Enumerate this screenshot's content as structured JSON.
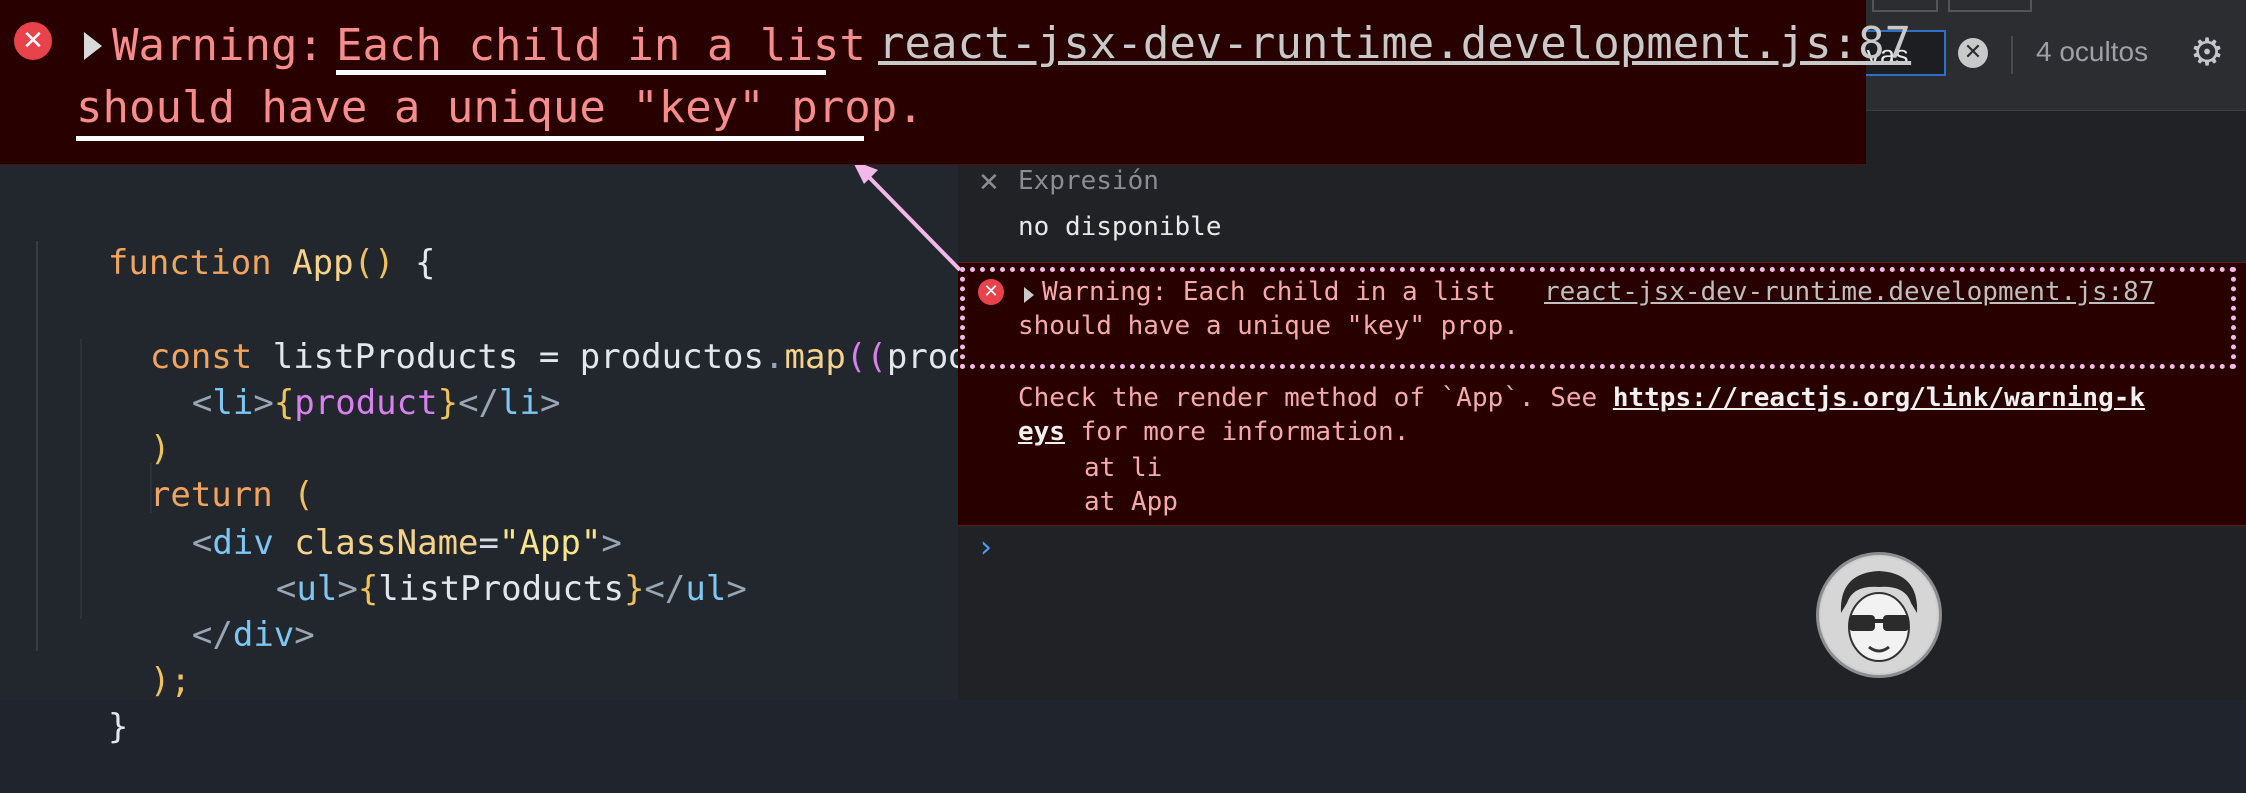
{
  "callout": {
    "warning_prefix": "Warning: ",
    "warning_highlight": "Each child in a list",
    "warning_line2": "should have a unique \"key\" prop.",
    "source_link": "react-jsx-dev-runtime.development.js:87"
  },
  "editor": {
    "lines": [
      {
        "parts": [
          "function",
          " ",
          "App",
          "()",
          " {"
        ]
      },
      {
        "parts": [
          "const",
          " listProducts = ",
          "productos",
          ".",
          "map",
          "((",
          "produc"
        ]
      },
      {
        "parts": [
          "<",
          "li",
          ">",
          "{",
          "product",
          "}",
          "</",
          "li",
          ">"
        ]
      },
      {
        "parts": [
          ")"
        ]
      },
      {
        "parts": [
          "return",
          " ("
        ]
      },
      {
        "parts": [
          "<",
          "div",
          " ",
          "className",
          "=",
          "\"App\"",
          ">"
        ]
      },
      {
        "parts": [
          "<",
          "ul",
          ">",
          "{",
          "listProducts",
          "}",
          "</",
          "ul",
          ">"
        ]
      },
      {
        "parts": [
          "</",
          "div",
          ">"
        ]
      },
      {
        "parts": [
          ");"
        ]
      },
      {
        "parts": [
          "}"
        ]
      }
    ]
  },
  "devtools": {
    "filter_value": "l/javas",
    "hidden_count": "4 ocultos",
    "expression_label": "Expresión",
    "expression_value": "no disponible",
    "error": {
      "line1_prefix": "Warning: Each child in a list",
      "source_link": "react-jsx-dev-runtime.development.js:87",
      "line2": "should have a unique \"key\" prop.",
      "detail_pre": "Check the render method of `App`. See ",
      "detail_url_part1": "https://reactjs.org/link/warning-k",
      "detail_url_part2": "eys",
      "detail_post": " for more information.",
      "stack_1": "at li",
      "stack_2": "at App"
    },
    "prompt_symbol": "›"
  },
  "colors": {
    "error_bg": "#290000",
    "error_text": "#f6a9a9",
    "callout_text": "#f78c8c",
    "accent_blue": "#2f6fc4",
    "dotted_border": "#f2b8e8"
  },
  "icons": [
    "error-icon",
    "expand-triangle-icon",
    "close-icon",
    "gear-icon",
    "clear-filter-icon",
    "prompt-chevron-icon",
    "avatar-image"
  ]
}
